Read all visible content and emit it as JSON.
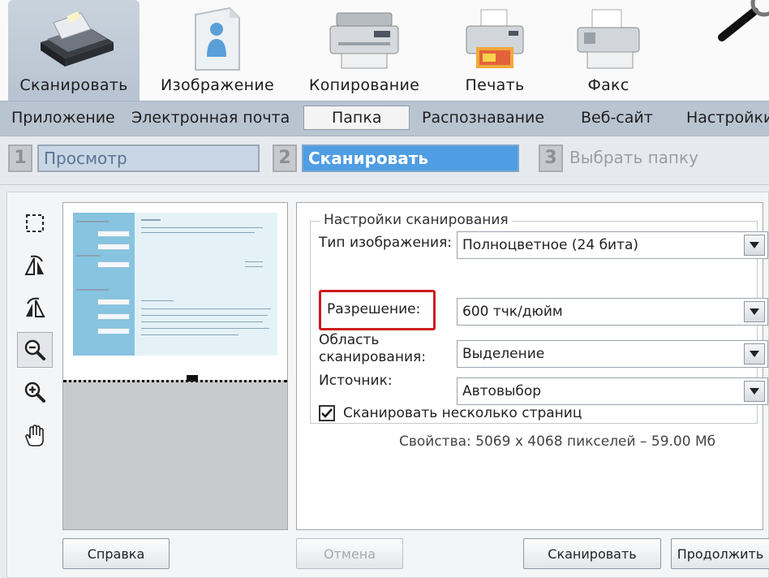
{
  "toolbar": {
    "tools": [
      {
        "label": "Сканировать",
        "icon": "scanner-icon"
      },
      {
        "label": "Изображение",
        "icon": "image-icon"
      },
      {
        "label": "Копирование",
        "icon": "copier-icon"
      },
      {
        "label": "Печать",
        "icon": "printer-icon"
      },
      {
        "label": "Факс",
        "icon": "fax-icon"
      }
    ],
    "active_index": 0
  },
  "menu": {
    "items": [
      "Приложение",
      "Электронная почта",
      "Папка",
      "Распознавание",
      "Веб-сайт",
      "Настройки"
    ],
    "selected": "Папка"
  },
  "steps": [
    {
      "number": "1",
      "label": "Просмотр",
      "state": "done"
    },
    {
      "number": "2",
      "label": "Сканировать",
      "state": "current"
    },
    {
      "number": "3",
      "label": "Выбрать папку",
      "state": "pending"
    }
  ],
  "side_tools": [
    "select-area-icon",
    "rotate-left-icon",
    "rotate-right-icon",
    "zoom-out-icon",
    "zoom-in-icon",
    "hand-pan-icon"
  ],
  "scan_settings": {
    "group_title": "Настройки сканирования",
    "image_type": {
      "label": "Тип изображения:",
      "value": "Полноцветное (24 бита)"
    },
    "resolution": {
      "label": "Разрешение:",
      "value": "600 тчк/дюйм"
    },
    "scan_area": {
      "label_line1": "Область",
      "label_line2": "сканирования:",
      "value": "Выделение"
    },
    "source": {
      "label": "Источник:",
      "value": "Автовыбор"
    },
    "multi_page": {
      "label": "Сканировать несколько страниц",
      "checked": true
    },
    "properties": "Свойства: 5069 x 4068 пикселей – 59.00 Мб"
  },
  "buttons": {
    "help": "Справка",
    "cancel": "Отмена",
    "scan": "Сканировать",
    "continue": "Продолжить"
  },
  "colors": {
    "accent": "#4f9de3",
    "highlight": "#cc1a1f",
    "menubar": "#b9c4d1"
  }
}
